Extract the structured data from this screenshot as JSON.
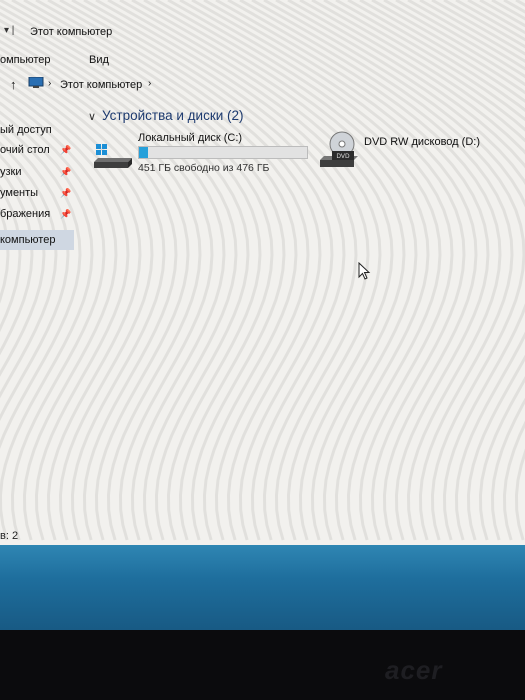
{
  "window": {
    "title": "Этот компьютер",
    "quick_access_symbols": "▾ |"
  },
  "ribbon": {
    "tab_computer": "омпьютер",
    "tab_view": "Вид"
  },
  "address": {
    "crumb": "Этот компьютер",
    "sep": "›"
  },
  "nav": {
    "items": [
      {
        "label": "ый доступ",
        "pinned": false,
        "selected": false
      },
      {
        "label": "очий стол",
        "pinned": true,
        "selected": false
      },
      {
        "label": "узки",
        "pinned": true,
        "selected": false
      },
      {
        "label": "ументы",
        "pinned": true,
        "selected": false
      },
      {
        "label": "бражения",
        "pinned": true,
        "selected": false
      },
      {
        "label": "компьютер",
        "pinned": false,
        "selected": true
      }
    ]
  },
  "group": {
    "title": "Устройства и диски (2)"
  },
  "drives": {
    "c": {
      "name": "Локальный диск (C:)",
      "free_text": "451 ГБ свободно из 476 ГБ",
      "used_fraction": 0.0525
    },
    "d": {
      "name": "DVD RW дисковод (D:)",
      "icon_label": "DVD"
    }
  },
  "status": {
    "text": "в: 2"
  },
  "brand": {
    "text": "acer"
  },
  "colors": {
    "accent": "#26a0da",
    "selection": "#cfd7e2",
    "taskbar": "#1e6e9d"
  }
}
